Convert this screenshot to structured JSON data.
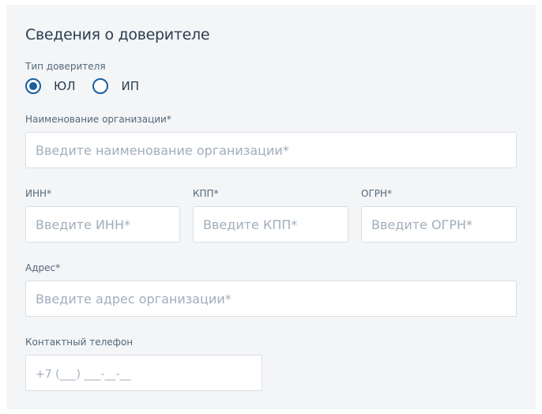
{
  "form": {
    "title": "Сведения о доверителе",
    "trustor_type": {
      "label": "Тип доверителя",
      "options": [
        "ЮЛ",
        "ИП"
      ],
      "selected": "ЮЛ"
    },
    "org_name": {
      "label": "Наименование организации*",
      "placeholder": "Введите наименование организации*",
      "value": ""
    },
    "inn": {
      "label": "ИНН*",
      "placeholder": "Введите ИНН*",
      "value": ""
    },
    "kpp": {
      "label": "КПП*",
      "placeholder": "Введите КПП*",
      "value": ""
    },
    "ogrn": {
      "label": "ОГРН*",
      "placeholder": "Введите ОГРН*",
      "value": ""
    },
    "address": {
      "label": "Адрес*",
      "placeholder": "Введите адрес организации*",
      "value": ""
    },
    "phone": {
      "label": "Контактный телефон",
      "placeholder": "+7 (___) ___-__-__",
      "value": ""
    }
  },
  "colors": {
    "panel_background": "#f3f5f7",
    "accent": "#1a5f9e",
    "input_border": "#d9dee4",
    "placeholder": "#a1aebb",
    "text": "#2b3d50"
  }
}
